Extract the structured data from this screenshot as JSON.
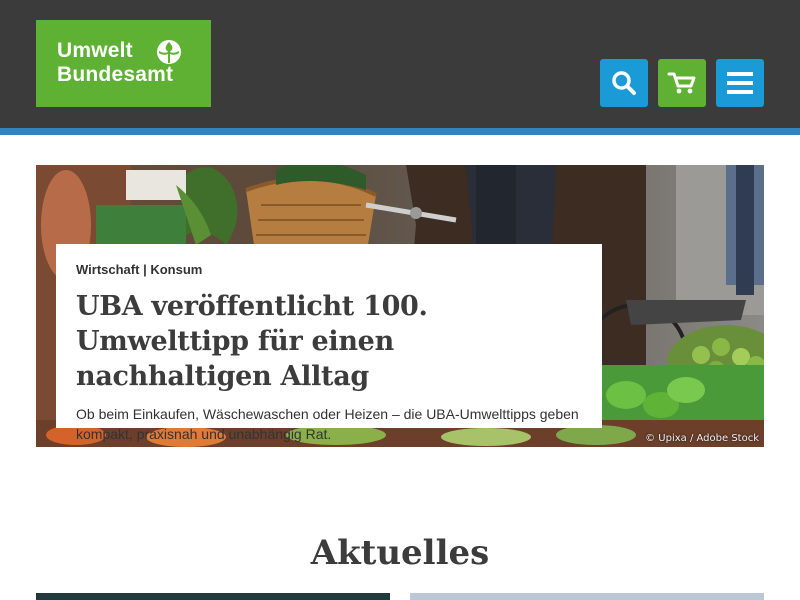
{
  "header": {
    "logo_line1": "Umwelt",
    "logo_line2": "Bundesamt",
    "logo_icon": "uba-emblem-icon",
    "search_icon": "search-icon",
    "cart_icon": "cart-icon",
    "menu_icon": "hamburger-menu-icon",
    "colors": {
      "bar": "#3b3b3b",
      "stripe": "#2f85c2",
      "logo": "#5eb132",
      "search": "#1a9bd7",
      "cart": "#5eb132",
      "menu": "#1a9bd7"
    }
  },
  "hero": {
    "credit": "© Upixa / Adobe Stock",
    "category_1": "Wirtschaft",
    "category_sep": " | ",
    "category_2": "Konsum",
    "title": "UBA veröffentlicht 100. Umwelttipp für einen nachhaltigen Alltag",
    "text": "Ob beim Einkaufen, Wäschewaschen oder Heizen – die UBA-Umwelttipps ge­ben kompakt, praxisnah und unabhängig Rat."
  },
  "section": {
    "title": "Aktuelles"
  }
}
